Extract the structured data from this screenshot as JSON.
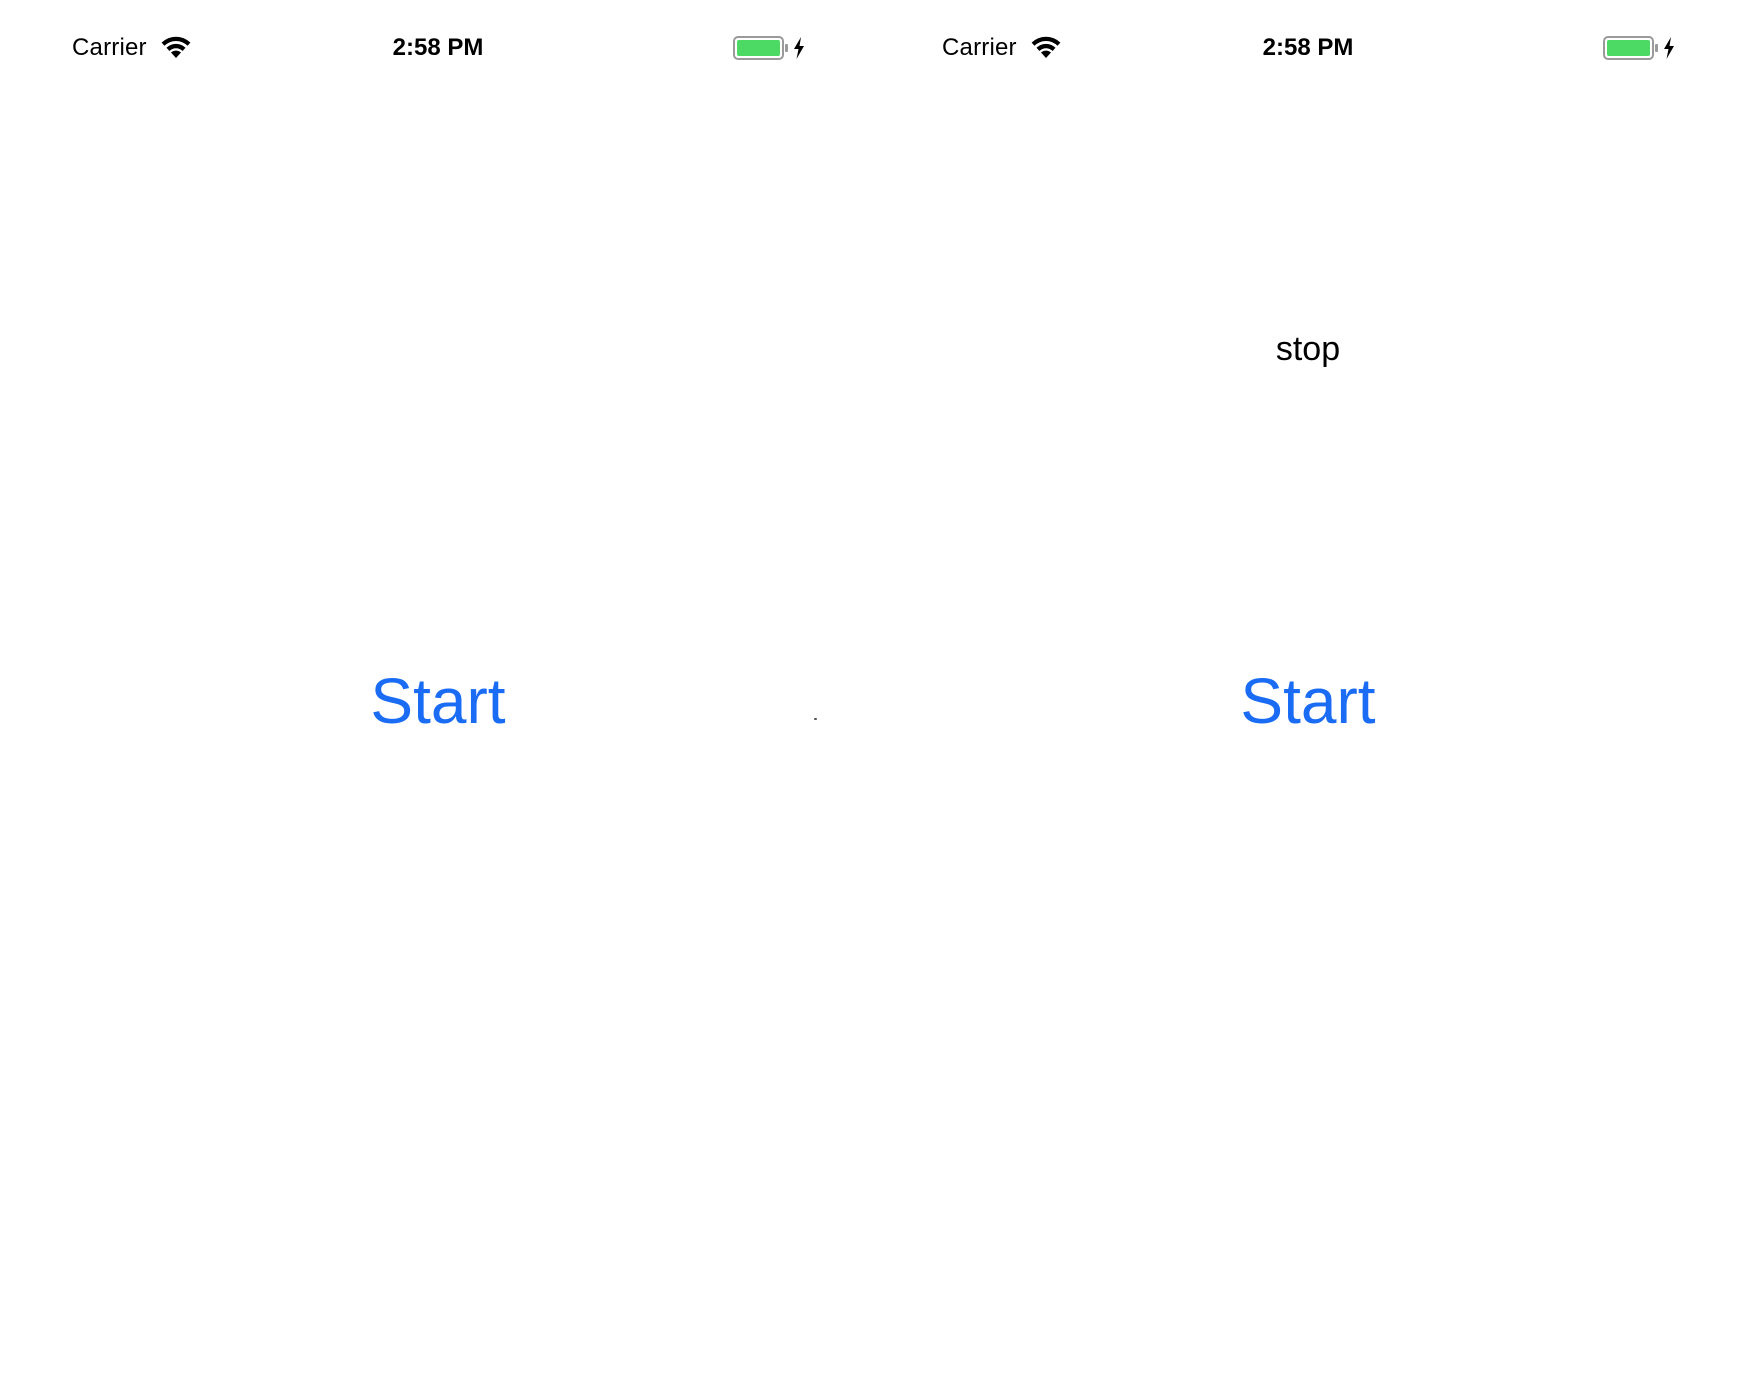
{
  "colors": {
    "accent": "#1a6cf5",
    "battery_fill": "#4cd964",
    "text": "#000000",
    "background": "#ffffff"
  },
  "screens": [
    {
      "status_bar": {
        "carrier": "Carrier",
        "time": "2:58 PM",
        "wifi_icon": "wifi-icon",
        "battery_icon": "battery-charging-icon",
        "battery_level": 1.0
      },
      "start_button_label": "Start"
    },
    {
      "status_bar": {
        "carrier": "Carrier",
        "time": "2:58 PM",
        "wifi_icon": "wifi-icon",
        "battery_icon": "battery-charging-icon",
        "battery_level": 1.0
      },
      "status_label": "stop",
      "start_button_label": "Start"
    }
  ]
}
